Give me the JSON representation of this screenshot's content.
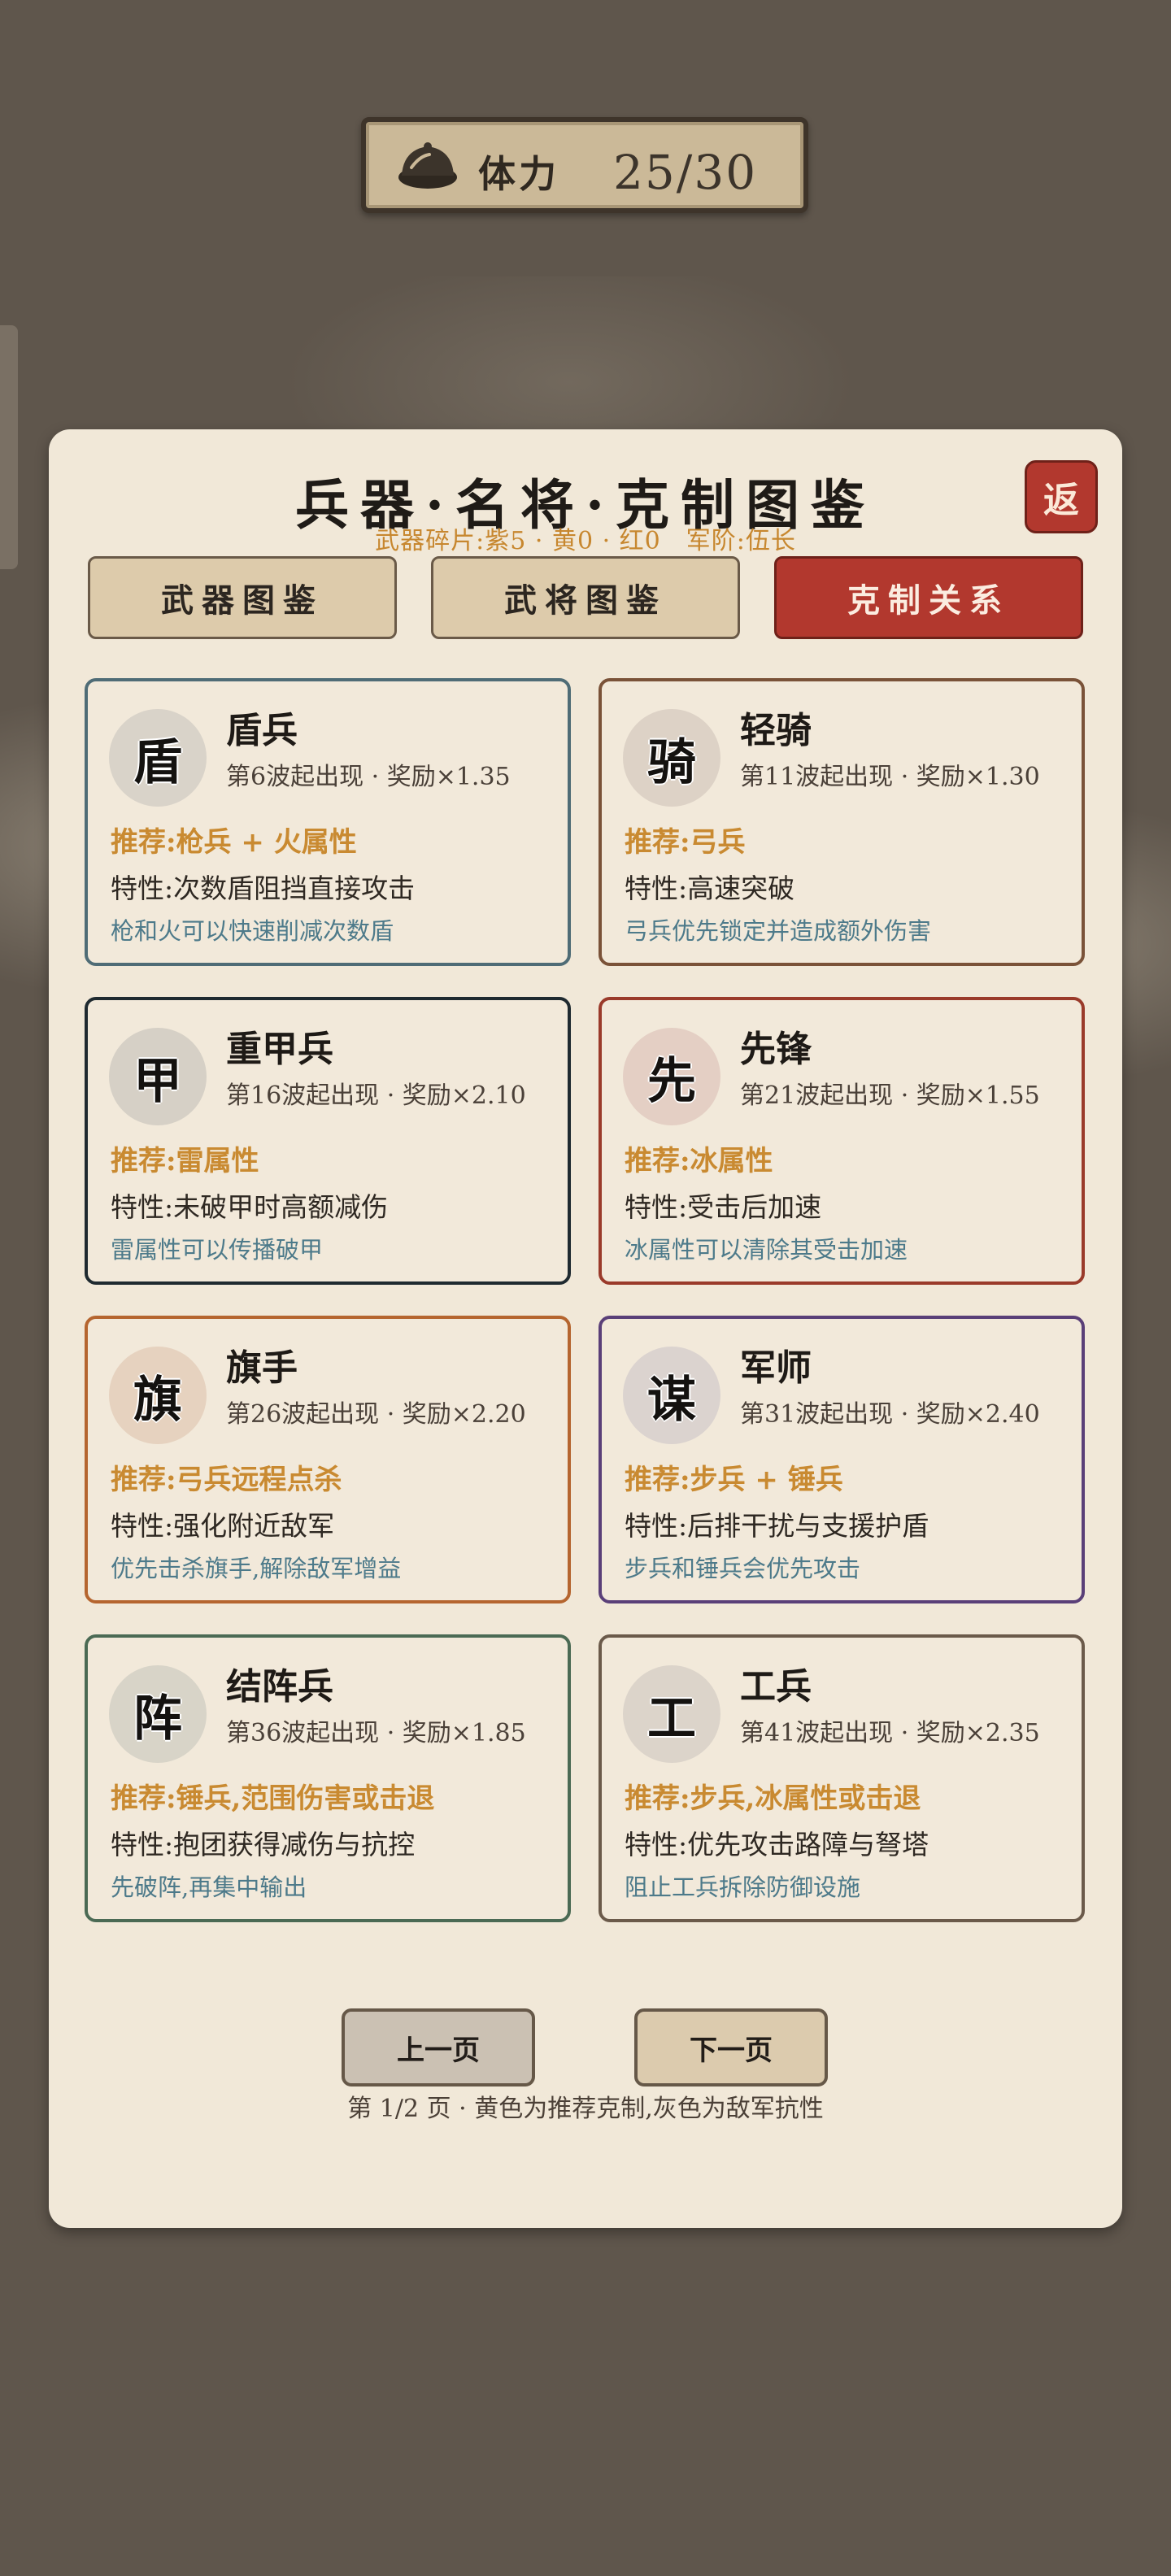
{
  "stamina": {
    "label": "体力",
    "value": "25/30",
    "icon": "bun-icon"
  },
  "panel": {
    "title": "兵器·名将·克制图鉴",
    "subtitle": "武器碎片:紫5 · 黄0 · 红0　军阶:伍长",
    "back_label": "返"
  },
  "tabs": [
    {
      "label": "武器图鉴",
      "active": false
    },
    {
      "label": "武将图鉴",
      "active": false
    },
    {
      "label": "克制关系",
      "active": true
    }
  ],
  "cards": [
    {
      "glyph": "盾",
      "name": "盾兵",
      "wave": "第6波起出现 · 奖励×1.35",
      "rec": "推荐:枪兵 + 火属性",
      "trait": "特性:次数盾阻挡直接攻击",
      "tip": "枪和火可以快速削减次数盾",
      "border_color": "#4f6c76",
      "glyph_bg": "#d9d3c9"
    },
    {
      "glyph": "骑",
      "name": "轻骑",
      "wave": "第11波起出现 · 奖励×1.30",
      "rec": "推荐:弓兵",
      "trait": "特性:高速突破",
      "tip": "弓兵优先锁定并造成额外伤害",
      "border_color": "#7a5238",
      "glyph_bg": "#ddd2c6"
    },
    {
      "glyph": "甲",
      "name": "重甲兵",
      "wave": "第16波起出现 · 奖励×2.10",
      "rec": "推荐:雷属性",
      "trait": "特性:未破甲时高额减伤",
      "tip": "雷属性可以传播破甲",
      "border_color": "#1f2a30",
      "glyph_bg": "#d6d0c6"
    },
    {
      "glyph": "先",
      "name": "先锋",
      "wave": "第21波起出现 · 奖励×1.55",
      "rec": "推荐:冰属性",
      "trait": "特性:受击后加速",
      "tip": "冰属性可以清除其受击加速",
      "border_color": "#9a3a2a",
      "glyph_bg": "#e4cfc4"
    },
    {
      "glyph": "旗",
      "name": "旗手",
      "wave": "第26波起出现 · 奖励×2.20",
      "rec": "推荐:弓兵远程点杀",
      "trait": "特性:强化附近敌军",
      "tip": "优先击杀旗手,解除敌军增益",
      "border_color": "#b5652f",
      "glyph_bg": "#e6d2bf"
    },
    {
      "glyph": "谋",
      "name": "军师",
      "wave": "第31波起出现 · 奖励×2.40",
      "rec": "推荐:步兵 + 锤兵",
      "trait": "特性:后排干扰与支援护盾",
      "tip": "步兵和锤兵会优先攻击",
      "border_color": "#5a3f78",
      "glyph_bg": "#dbd3cf"
    },
    {
      "glyph": "阵",
      "name": "结阵兵",
      "wave": "第36波起出现 · 奖励×1.85",
      "rec": "推荐:锤兵,范围伤害或击退",
      "trait": "特性:抱团获得减伤与抗控",
      "tip": "先破阵,再集中输出",
      "border_color": "#4b6a54",
      "glyph_bg": "#d8d4c8"
    },
    {
      "glyph": "工",
      "name": "工兵",
      "wave": "第41波起出现 · 奖励×2.35",
      "rec": "推荐:步兵,冰属性或击退",
      "trait": "特性:优先攻击路障与弩塔",
      "tip": "阻止工兵拆除防御设施",
      "border_color": "#6b5a4a",
      "glyph_bg": "#dcd4ca"
    }
  ],
  "pagination": {
    "prev_label": "上一页",
    "next_label": "下一页",
    "info": "第 1/2 页 · 黄色为推荐克制,灰色为敌军抗性"
  }
}
